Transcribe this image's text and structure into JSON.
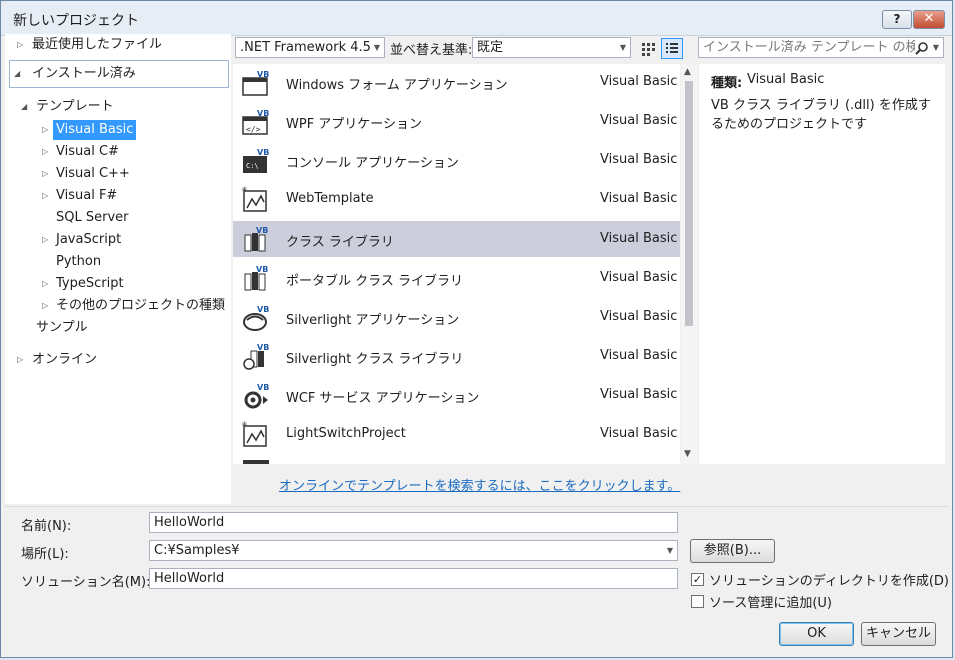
{
  "window": {
    "title": "新しいプロジェクト",
    "help_label": "?",
    "close_label": "✕"
  },
  "left_tree": {
    "recent": "最近使用したファイル",
    "installed": "インストール済み",
    "templates": "テンプレート",
    "languages": [
      "Visual Basic",
      "Visual C#",
      "Visual C++",
      "Visual F#",
      "SQL Server",
      "JavaScript",
      "Python",
      "TypeScript",
      "その他のプロジェクトの種類"
    ],
    "samples": "サンプル",
    "online": "オンライン"
  },
  "toolbar": {
    "framework": ".NET Framework 4.5",
    "sort_label": "並べ替え基準:",
    "sort_value": "既定",
    "search_placeholder": "インストール済み テンプレート の検索"
  },
  "templates": [
    {
      "name": "Windows フォーム アプリケーション",
      "lang": "Visual Basic"
    },
    {
      "name": "WPF アプリケーション",
      "lang": "Visual Basic"
    },
    {
      "name": "コンソール アプリケーション",
      "lang": "Visual Basic"
    },
    {
      "name": "WebTemplate",
      "lang": "Visual Basic"
    },
    {
      "name": "クラス ライブラリ",
      "lang": "Visual Basic"
    },
    {
      "name": "ポータブル クラス ライブラリ",
      "lang": "Visual Basic"
    },
    {
      "name": "Silverlight アプリケーション",
      "lang": "Visual Basic"
    },
    {
      "name": "Silverlight クラス ライブラリ",
      "lang": "Visual Basic"
    },
    {
      "name": "WCF サービス アプリケーション",
      "lang": "Visual Basic"
    },
    {
      "name": "LightSwitchProject",
      "lang": "Visual Basic"
    }
  ],
  "details": {
    "type_label": "種類:",
    "type_value": "Visual Basic",
    "description": "VB クラス ライブラリ (.dll) を作成するためのプロジェクトです"
  },
  "online_link": "オンラインでテンプレートを検索するには、ここをクリックします。",
  "form": {
    "name_label": "名前(N):",
    "name_value": "HelloWorld",
    "location_label": "場所(L):",
    "location_value": "C:¥Samples¥",
    "solution_label": "ソリューション名(M):",
    "solution_value": "HelloWorld",
    "browse_label": "参照(B)...",
    "create_dir_label": "ソリューションのディレクトリを作成(D)",
    "create_dir_checked": true,
    "source_control_label": "ソース管理に追加(U)",
    "source_control_checked": false,
    "ok_label": "OK",
    "cancel_label": "キャンセル"
  },
  "colors": {
    "selection_blue": "#3399ff",
    "selected_row": "#cccedb",
    "link": "#1a6ac0",
    "vb_badge": "#1e5aa8"
  }
}
